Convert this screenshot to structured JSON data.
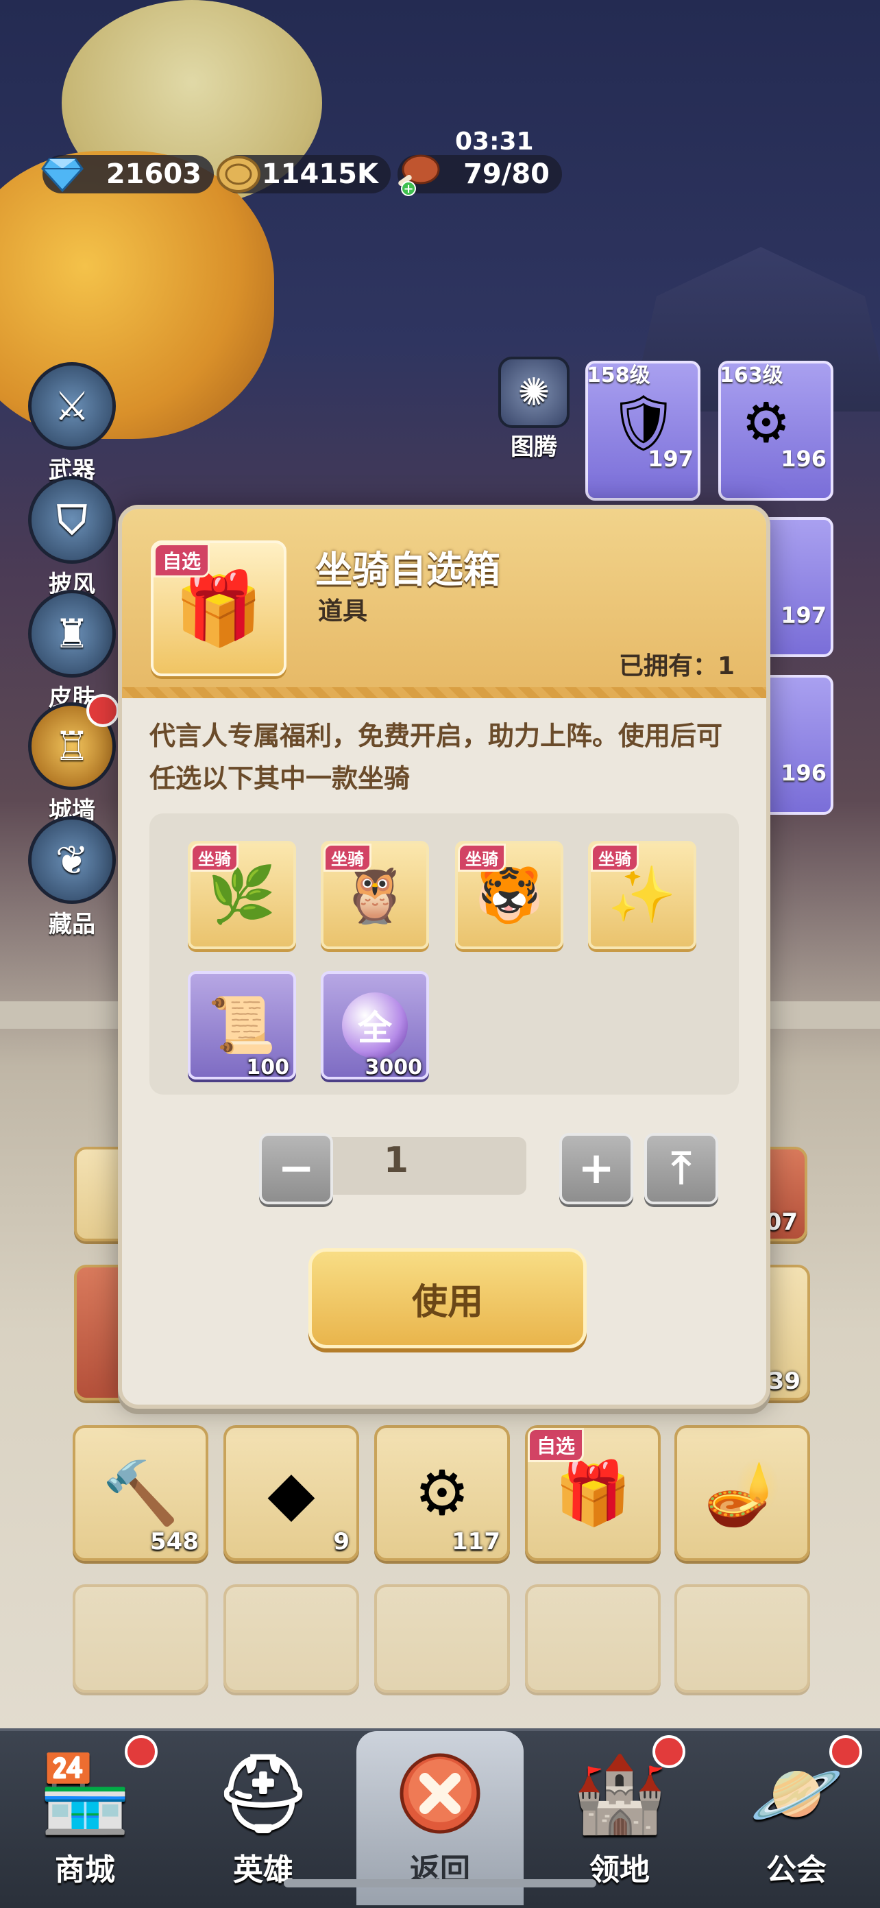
{
  "topbar": {
    "gems": "21603",
    "coins": "11415K",
    "stamina": "79/80",
    "timer": "03:31"
  },
  "side_menu": [
    {
      "label": "武器",
      "icon": "weapon-icon"
    },
    {
      "label": "披风",
      "icon": "cape-icon"
    },
    {
      "label": "皮肤",
      "icon": "skin-icon"
    },
    {
      "label": "城墙",
      "icon": "castle-wall-icon"
    },
    {
      "label": "藏品",
      "icon": "collection-icon"
    }
  ],
  "totem_label": "图腾",
  "hero_cards": [
    {
      "level": "158级",
      "count": "197"
    },
    {
      "level": "163级",
      "count": "196"
    },
    {
      "count": "197"
    },
    {
      "count": "196"
    }
  ],
  "inventory": {
    "partial_counts": [
      "107",
      "39"
    ],
    "row": [
      {
        "count": "548",
        "icon": "hammer-icon"
      },
      {
        "count": "9",
        "icon": "crystal-icon"
      },
      {
        "count": "117",
        "icon": "gear-orb-icon"
      },
      {
        "tag": "自选",
        "icon": "chest-icon"
      },
      {
        "icon": "lamp-icon"
      }
    ]
  },
  "modal": {
    "tag": "自选",
    "title": "坐骑自选箱",
    "type": "道具",
    "owned": "已拥有：1",
    "description": "代言人专属福利，免费开启，助力上阵。使用后可任选以下其中一款坐骑",
    "rewards": [
      {
        "tag": "坐骑",
        "icon": "green-bush-mount-icon"
      },
      {
        "tag": "坐骑",
        "icon": "owl-mount-icon"
      },
      {
        "tag": "坐骑",
        "icon": "tiger-mount-icon"
      },
      {
        "tag": "坐骑",
        "icon": "star-spirit-mount-icon"
      },
      {
        "count": "100",
        "icon": "integral-scroll-icon"
      },
      {
        "count": "3000",
        "icon": "orb-all-icon",
        "badge": "全"
      }
    ],
    "quantity": "1",
    "use_button": "使用"
  },
  "nav": [
    {
      "label": "商城",
      "icon": "shop-icon",
      "badge": true
    },
    {
      "label": "英雄",
      "icon": "hero-helmet-icon",
      "badge": false
    },
    {
      "label": "返回",
      "icon": "close-icon",
      "badge": false
    },
    {
      "label": "领地",
      "icon": "territory-castle-icon",
      "badge": true
    },
    {
      "label": "公会",
      "icon": "guild-planet-icon",
      "badge": true
    }
  ],
  "colors": {
    "accent": "#e9b54c",
    "badge": "#e23b3b",
    "tag": "#d24364"
  }
}
